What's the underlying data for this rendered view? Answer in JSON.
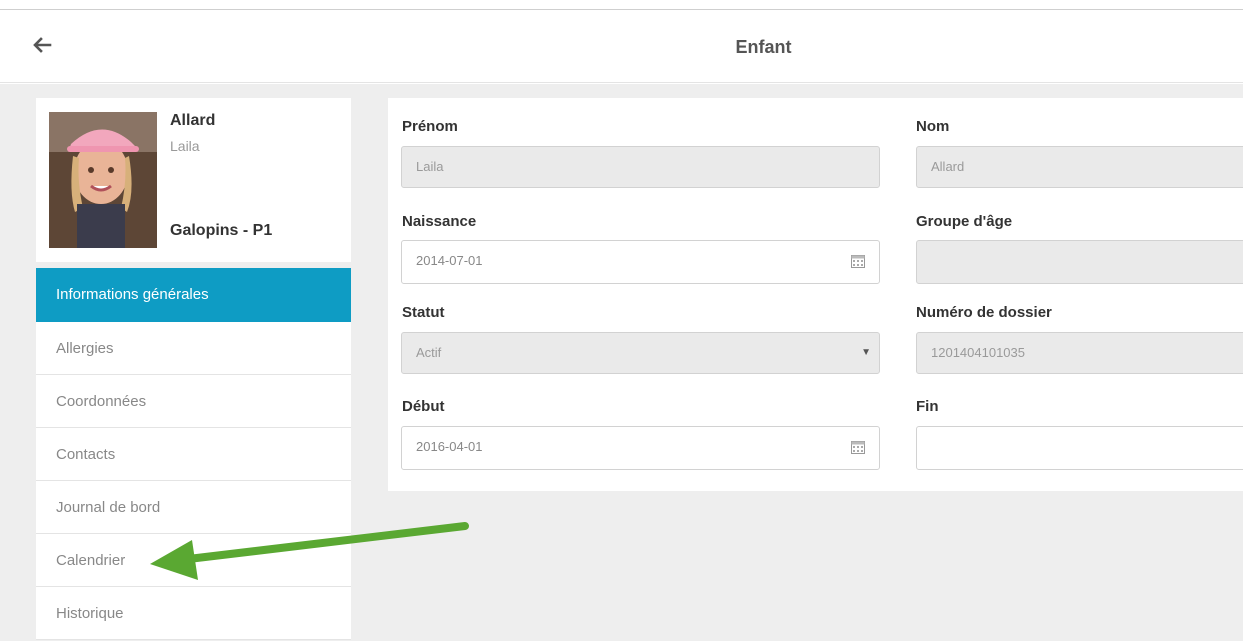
{
  "header": {
    "title": "Enfant",
    "back_icon": "arrow-left-icon"
  },
  "child": {
    "lastname": "Allard",
    "firstname": "Laila",
    "group": "Galopins - P1"
  },
  "sidebar": {
    "items": [
      {
        "label": "Informations générales",
        "active": true
      },
      {
        "label": "Allergies"
      },
      {
        "label": "Coordonnées"
      },
      {
        "label": "Contacts"
      },
      {
        "label": "Journal de bord"
      },
      {
        "label": "Calendrier"
      },
      {
        "label": "Historique"
      }
    ]
  },
  "form": {
    "prenom": {
      "label": "Prénom",
      "value": "Laila"
    },
    "nom": {
      "label": "Nom",
      "value": "Allard"
    },
    "naissance": {
      "label": "Naissance",
      "value": "2014-07-01"
    },
    "groupe_age": {
      "label": "Groupe d'âge",
      "value": ""
    },
    "statut": {
      "label": "Statut",
      "value": "Actif"
    },
    "numero_dossier": {
      "label": "Numéro de dossier",
      "value": "1201404101035"
    },
    "debut": {
      "label": "Début",
      "value": "2016-04-01"
    },
    "fin": {
      "label": "Fin",
      "value": ""
    }
  },
  "colors": {
    "accent": "#0e9cc4",
    "annotation_arrow": "#5aa832"
  }
}
